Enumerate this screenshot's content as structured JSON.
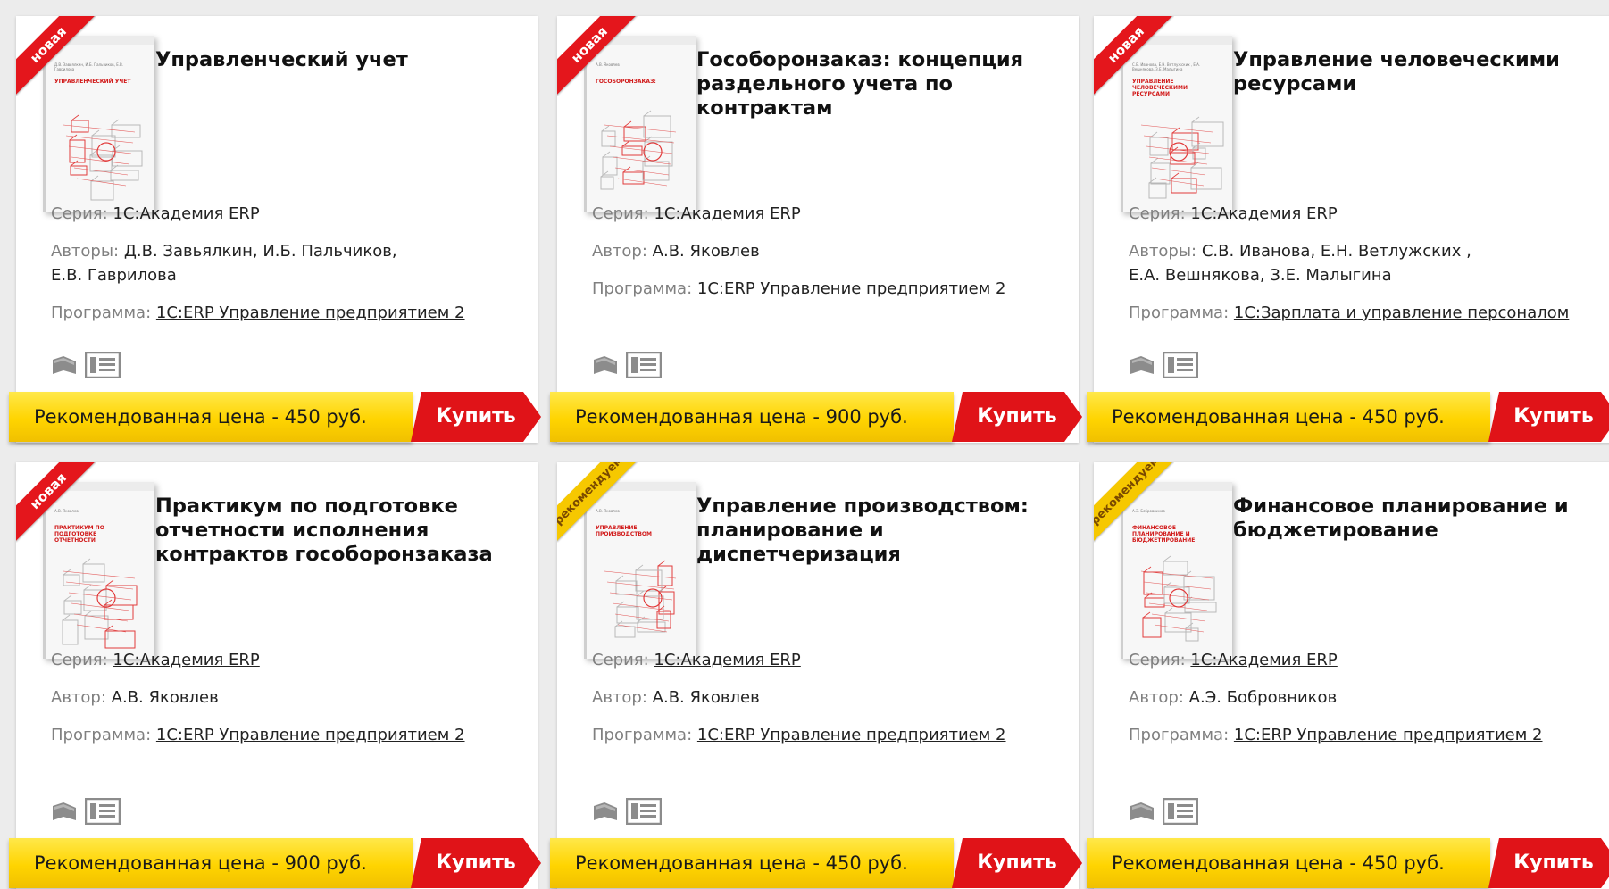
{
  "labels": {
    "series": "Серия:",
    "author": "Автор:",
    "authors": "Авторы:",
    "program": "Программа:",
    "buy": "Купить"
  },
  "badges": {
    "new": "новая",
    "recommended": "рекомендуем"
  },
  "colors": {
    "accent_red": "#e01318",
    "price_yellow": "#ffd400",
    "badge_yellow": "#f6c800"
  },
  "icons": [
    "book-icon",
    "description-icon"
  ],
  "cards": [
    {
      "badge": "новая",
      "title": "Управленческий учет",
      "cover_title": "Управленческий учет",
      "series": "1С:Академия ERP",
      "author_label": "Авторы:",
      "authors": "Д.В. Завьялкин, И.Б. Пальчиков, Е.В. Гаврилова",
      "program": "1С:ERP Управление предприятием 2",
      "price": "Рекомендованная цена - 450 руб."
    },
    {
      "badge": "новая",
      "title": "Гособоронзаказ: концепция раздельного учета по контрактам",
      "cover_title": "Гособоронзаказ:",
      "series": "1С:Академия ERP",
      "author_label": "Автор:",
      "authors": "А.В. Яковлев",
      "program": "1С:ERP Управление предприятием 2",
      "price": "Рекомендованная цена - 900 руб."
    },
    {
      "badge": "новая",
      "title": "Управление человеческими ресурсами",
      "cover_title": "Управление человеческими ресурсами",
      "series": "1С:Академия ERP",
      "author_label": "Авторы:",
      "authors": "С.В. Иванова, Е.Н. Ветлужских , Е.А. Вешнякова, З.Е. Малыгина",
      "program": "1С:Зарплата и управление персоналом",
      "price": "Рекомендованная цена - 450 руб."
    },
    {
      "badge": "новая",
      "title": "Практикум по подготовке отчетности исполнения контрактов гособоронзаказа",
      "cover_title": "Практикум по подготовке отчетности",
      "series": "1С:Академия ERP",
      "author_label": "Автор:",
      "authors": "А.В. Яковлев",
      "program": "1С:ERP Управление предприятием 2",
      "price": "Рекомендованная цена - 900 руб."
    },
    {
      "badge": "рекомендуем",
      "title": "Управление производством: планирование и диспетчеризация",
      "cover_title": "Управление производством",
      "series": "1С:Академия ERP",
      "author_label": "Автор:",
      "authors": "А.В. Яковлев",
      "program": "1С:ERP Управление предприятием 2",
      "price": "Рекомендованная цена - 450 руб."
    },
    {
      "badge": "рекомендуем",
      "title": "Финансовое планирование и бюджетирование",
      "cover_title": "Финансовое планирование и бюджетирование",
      "series": "1С:Академия ERP",
      "author_label": "Автор:",
      "authors": "А.Э. Бобровников",
      "program": "1С:ERP Управление предприятием 2",
      "price": "Рекомендованная цена - 450 руб."
    }
  ]
}
